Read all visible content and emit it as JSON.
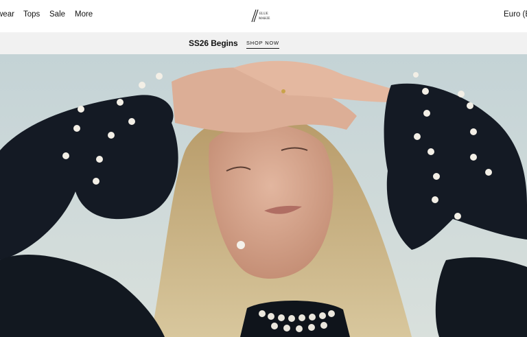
{
  "header": {
    "nav_items": [
      {
        "label": "wear",
        "name": "nav-item-wear"
      },
      {
        "label": "Tops",
        "name": "nav-item-tops"
      },
      {
        "label": "Sale",
        "name": "nav-item-sale"
      },
      {
        "label": "More",
        "name": "nav-item-more"
      }
    ],
    "logo_text": "ELUE MAKIE",
    "currency": "Euro (EU"
  },
  "promo": {
    "title": "SS26 Begins",
    "cta": "SHOP NOW"
  },
  "hero": {
    "image_subject": "woman-with-pearl-cuff-sleeves"
  }
}
